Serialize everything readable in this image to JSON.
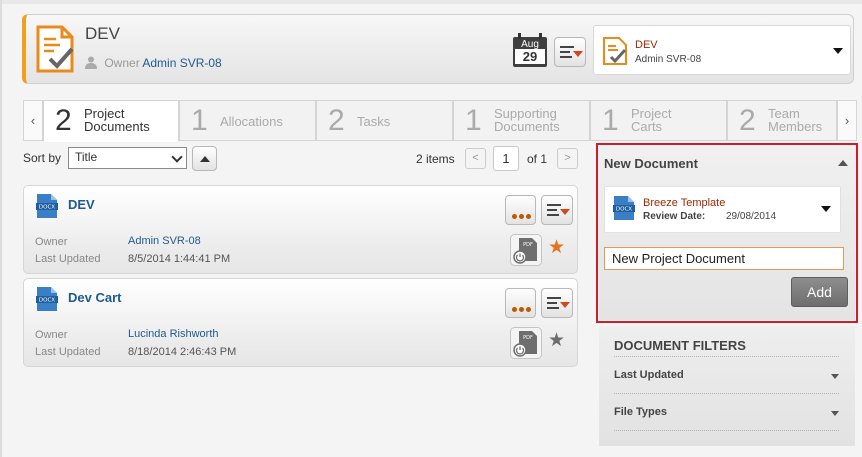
{
  "header": {
    "title": "DEV",
    "owner_label": "Owner",
    "owner_name": "Admin SVR-08",
    "calendar_month": "Aug",
    "calendar_day": "29",
    "owner_select": {
      "name": "DEV",
      "owner": "Admin SVR-08"
    }
  },
  "tabs": [
    {
      "count": "2",
      "label": "Project Documents",
      "active": true
    },
    {
      "count": "1",
      "label": "Allocations",
      "active": false
    },
    {
      "count": "2",
      "label": "Tasks",
      "active": false
    },
    {
      "count": "1",
      "label": "Supporting Documents",
      "active": false
    },
    {
      "count": "1",
      "label": "Project Carts",
      "active": false
    },
    {
      "count": "2",
      "label": "Team Members",
      "active": false
    }
  ],
  "tab_nav": {
    "prev": "‹",
    "next": "›"
  },
  "sort": {
    "label": "Sort by",
    "value": "Title"
  },
  "pagination": {
    "items": "2 items",
    "prev": "<",
    "page": "1",
    "of": "of 1",
    "next": ">"
  },
  "documents": [
    {
      "title": "DEV",
      "owner_label": "Owner",
      "owner": "Admin SVR-08",
      "updated_label": "Last Updated",
      "updated": "8/5/2014 1:44:41 PM",
      "starred": true
    },
    {
      "title": "Dev Cart",
      "owner_label": "Owner",
      "owner": "Lucinda Rishworth",
      "updated_label": "Last Updated",
      "updated": "8/18/2014 2:46:43 PM",
      "starred": false
    }
  ],
  "new_document": {
    "heading": "New Document",
    "template_name": "Breeze Template",
    "review_label": "Review Date:",
    "review_date": "29/08/2014",
    "name_value": "New Project Document",
    "add_label": "Add"
  },
  "filters": {
    "heading": "DOCUMENT FILTERS",
    "items": [
      "Last Updated",
      "File Types"
    ]
  },
  "colors": {
    "accent": "#f0a020",
    "link": "#1f5a8e",
    "highlight_outline": "#d01c2a",
    "star_active": "#e4721f",
    "star_inactive": "#6d6d6d"
  }
}
